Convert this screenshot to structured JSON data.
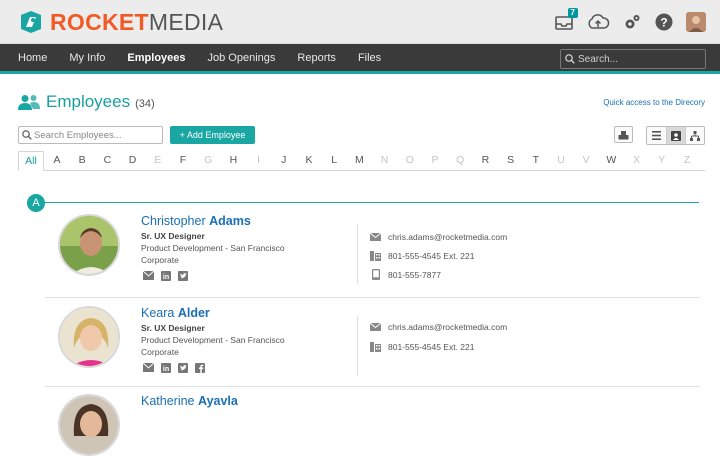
{
  "app": {
    "brand_part1": "ROCKET",
    "brand_part2": "MEDIA"
  },
  "header": {
    "inbox_badge": "7"
  },
  "nav": {
    "items": [
      "Home",
      "My Info",
      "Employees",
      "Job Openings",
      "Reports",
      "Files"
    ],
    "active": "Employees",
    "search_placeholder": "Search..."
  },
  "page": {
    "title": "Employees",
    "count": "(34)",
    "quick_link": "Quick access to the Direcory"
  },
  "toolbar": {
    "search_placeholder": "Search Employees...",
    "add_label": "+ Add Employee"
  },
  "alphabet": {
    "all_label": "All",
    "letters": [
      {
        "l": "A",
        "on": true
      },
      {
        "l": "B",
        "on": true
      },
      {
        "l": "C",
        "on": true
      },
      {
        "l": "D",
        "on": true
      },
      {
        "l": "E",
        "on": false
      },
      {
        "l": "F",
        "on": true
      },
      {
        "l": "G",
        "on": false
      },
      {
        "l": "H",
        "on": true
      },
      {
        "l": "I",
        "on": false
      },
      {
        "l": "J",
        "on": true
      },
      {
        "l": "K",
        "on": true
      },
      {
        "l": "L",
        "on": true
      },
      {
        "l": "M",
        "on": true
      },
      {
        "l": "N",
        "on": false
      },
      {
        "l": "O",
        "on": false
      },
      {
        "l": "P",
        "on": false
      },
      {
        "l": "Q",
        "on": false
      },
      {
        "l": "R",
        "on": true
      },
      {
        "l": "S",
        "on": true
      },
      {
        "l": "T",
        "on": true
      },
      {
        "l": "U",
        "on": false
      },
      {
        "l": "V",
        "on": false
      },
      {
        "l": "W",
        "on": true
      },
      {
        "l": "X",
        "on": false
      },
      {
        "l": "Y",
        "on": false
      },
      {
        "l": "Z",
        "on": false
      }
    ]
  },
  "section_letter": "A",
  "employees": [
    {
      "first": "Christopher",
      "last": "Adams",
      "title": "Sr. UX Designer",
      "department": "Product Development - San Francisco",
      "division": "Corporate",
      "email": "chris.adams@rocketmedia.com",
      "work_phone": "801-555-4545 Ext. 221",
      "mobile": "801-555-7877",
      "socials": [
        "email-icon",
        "linkedin-icon",
        "twitter-icon"
      ]
    },
    {
      "first": "Keara",
      "last": "Alder",
      "title": "Sr. UX Designer",
      "department": "Product Development - San Francisco",
      "division": "Corporate",
      "email": "chris.adams@rocketmedia.com",
      "work_phone": "801-555-4545 Ext. 221",
      "socials": [
        "email-icon",
        "linkedin-icon",
        "twitter-icon",
        "facebook-icon"
      ]
    },
    {
      "first": "Katherine",
      "last": "Ayavla"
    }
  ],
  "colors": {
    "accent": "#1aa6a3",
    "brand_orange": "#f15a24",
    "link": "#1a6fb5",
    "nav_bg": "#3a3a3a"
  }
}
